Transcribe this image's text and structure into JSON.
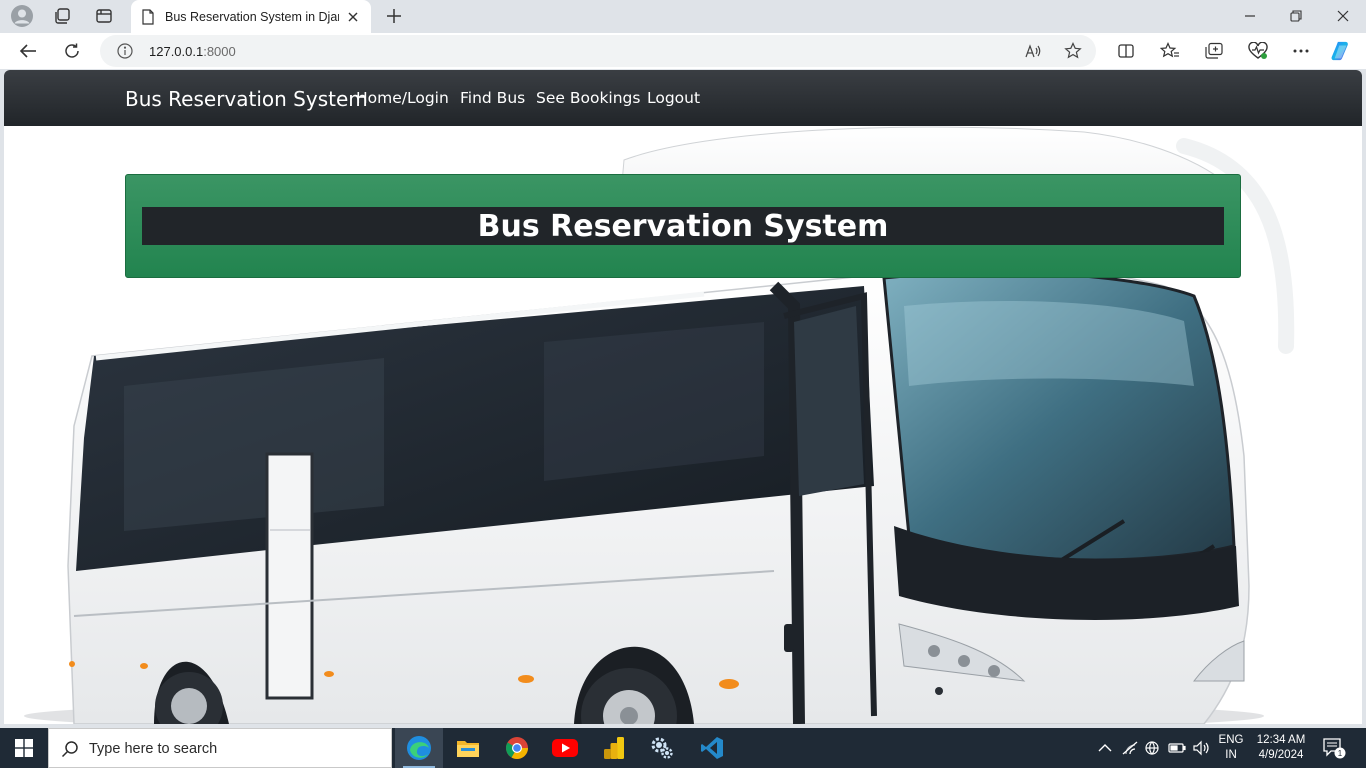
{
  "browser": {
    "tab_title": "Bus Reservation System in Djang",
    "url_host": "127.0.0.1",
    "url_port": ":8000"
  },
  "site": {
    "brand": "Bus Reservation System",
    "nav": [
      {
        "label": "Home/Login"
      },
      {
        "label": "Find Bus"
      },
      {
        "label": "See Bookings"
      },
      {
        "label": "Logout"
      }
    ],
    "jumbotron_title": "Bus Reservation System"
  },
  "taskbar": {
    "search_placeholder": "Type here to search",
    "language_line1": "ENG",
    "language_line2": "IN",
    "time": "12:34 AM",
    "date": "4/9/2024",
    "notification_count": "1"
  },
  "colors": {
    "navbar": "#212529",
    "jumbotron": "#2b8a57",
    "taskbar": "#1f2a36"
  }
}
